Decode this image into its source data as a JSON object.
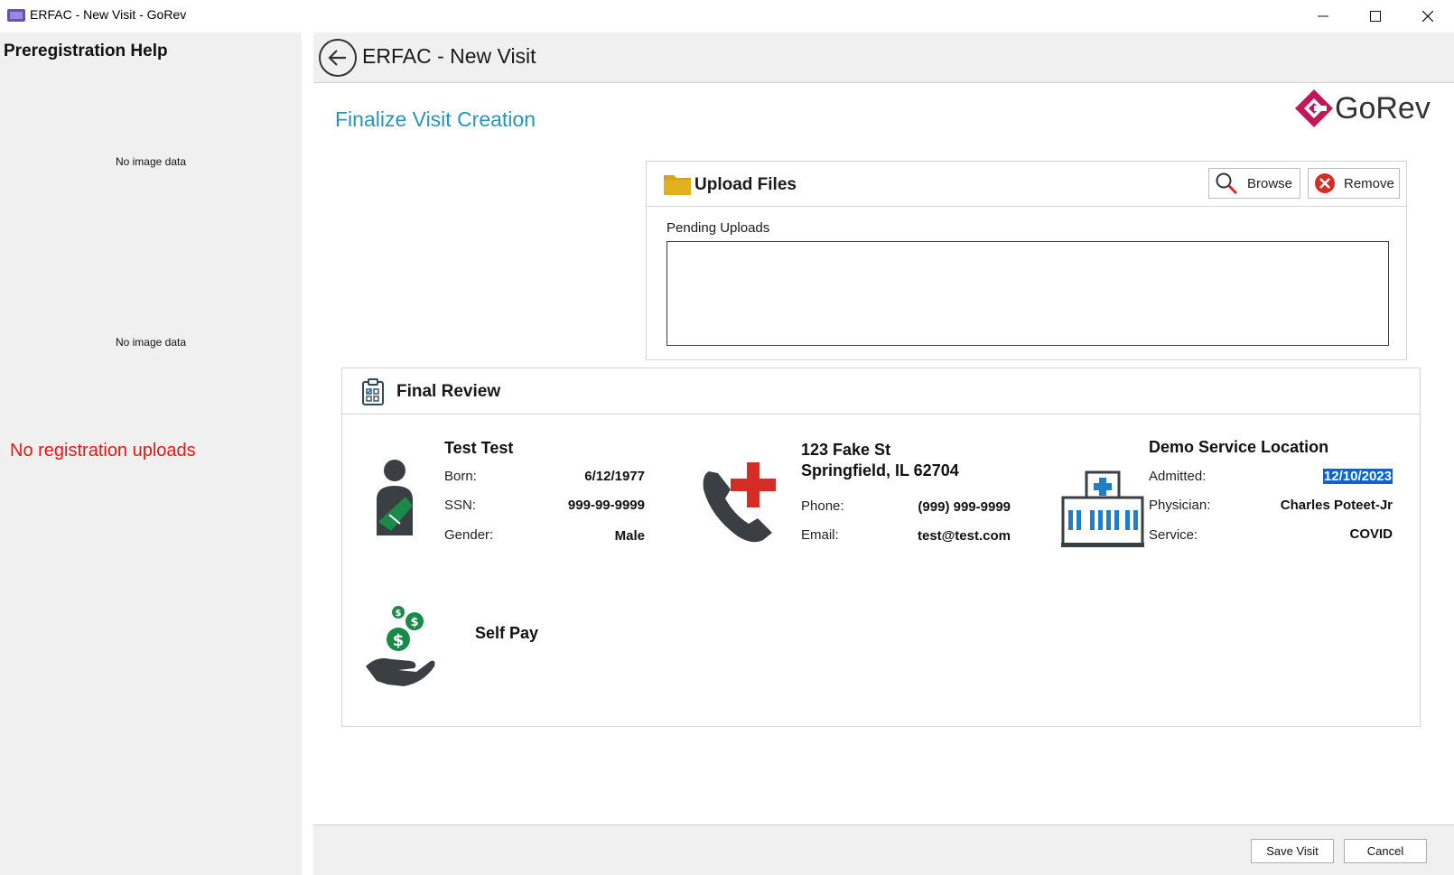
{
  "window": {
    "title": "ERFAC - New Visit - GoRev",
    "app_icon": "gorev-app-icon",
    "controls": [
      "minimize-icon",
      "maximize-icon",
      "close-icon"
    ]
  },
  "left_pane": {
    "title": "Preregistration Help",
    "image_placeholder_1": "No image data",
    "image_placeholder_2": "No image data",
    "no_uploads_message": "No registration uploads"
  },
  "header": {
    "back_icon": "arrow-left-icon",
    "title": "ERFAC - New Visit"
  },
  "main": {
    "section_title": "Finalize Visit Creation",
    "logo_text": "GoRev"
  },
  "upload": {
    "title": "Upload Files",
    "icon": "folder-icon",
    "browse_label": "Browse",
    "remove_label": "Remove",
    "pending_label": "Pending Uploads",
    "pending_items": []
  },
  "review": {
    "title": "Final Review",
    "patient": {
      "name": "Test Test",
      "born_label": "Born:",
      "born": "6/12/1977",
      "ssn_label": "SSN:",
      "ssn": "999-99-9999",
      "gender_label": "Gender:",
      "gender": "Male"
    },
    "contact": {
      "address_line1": "123 Fake St",
      "address_line2": "Springfield, IL 62704",
      "phone_label": "Phone:",
      "phone": "(999) 999-9999",
      "email_label": "Email:",
      "email": "test@test.com"
    },
    "location": {
      "name": "Demo Service Location",
      "admitted_label": "Admitted:",
      "admitted": "12/10/2023",
      "physician_label": "Physician:",
      "physician": "Charles Poteet-Jr",
      "service_label": "Service:",
      "service": "COVID"
    },
    "payer": {
      "label": "Self Pay"
    }
  },
  "footer": {
    "save_label": "Save Visit",
    "cancel_label": "Cancel"
  },
  "colors": {
    "accent": "#2596b9",
    "error": "#e8170f",
    "selection": "#0a64d2",
    "patient_green": "#1a8a4a",
    "cross_red": "#d62c26",
    "hospital_blue": "#1e7ec8",
    "logo_magenta": "#c2185b"
  }
}
